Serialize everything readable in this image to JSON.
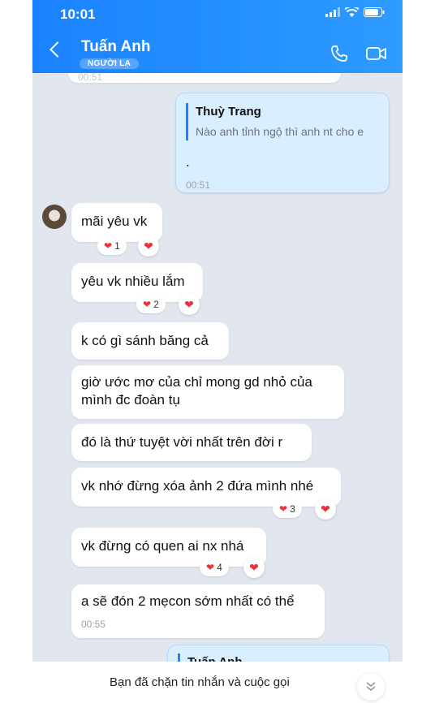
{
  "status_bar": {
    "time": "10:01"
  },
  "header": {
    "name": "Tuấn Anh",
    "badge": "NGƯỜI LẠ"
  },
  "messages": {
    "top_clip_time": "00:51",
    "reply_quote_name": "Thuỳ Trang",
    "reply_quote_text": "Nào anh tỉnh ngộ thì anh nt cho e",
    "reply_body": ".",
    "reply_time": "00:51",
    "m1": "mãi yêu vk",
    "m1_react": "1",
    "m2": "yêu vk nhiều lắm",
    "m2_react": "2",
    "m3": "k có gì sánh băng cả",
    "m4": "giờ ước mơ của chỉ mong gd nhỏ của mình đc đoàn tụ",
    "m5": "đó là thứ tuyệt vời nhất trên đời r",
    "m6": "vk nhớ đừng xóa ảnh 2 đứa mình nhé",
    "m6_react": "3",
    "m7": "vk đừng có quen ai nx nhá",
    "m7_react": "4",
    "m8": "a sẽ đón 2 mẹcon sớm nhất có thể",
    "m8_time": "00:55",
    "bottom_quote_name": "Tuấn Anh"
  },
  "footer": {
    "notice": "Bạn đã chặn tin nhắn và cuộc gọi"
  },
  "colors": {
    "accent": "#1a82ff",
    "heart": "#e8323c",
    "chat_bg": "#e2e6ee",
    "my_bubble": "#d9eeff"
  },
  "icons": [
    "back-icon",
    "phone-icon",
    "video-icon",
    "heart-icon",
    "chevron-down-double-icon"
  ]
}
